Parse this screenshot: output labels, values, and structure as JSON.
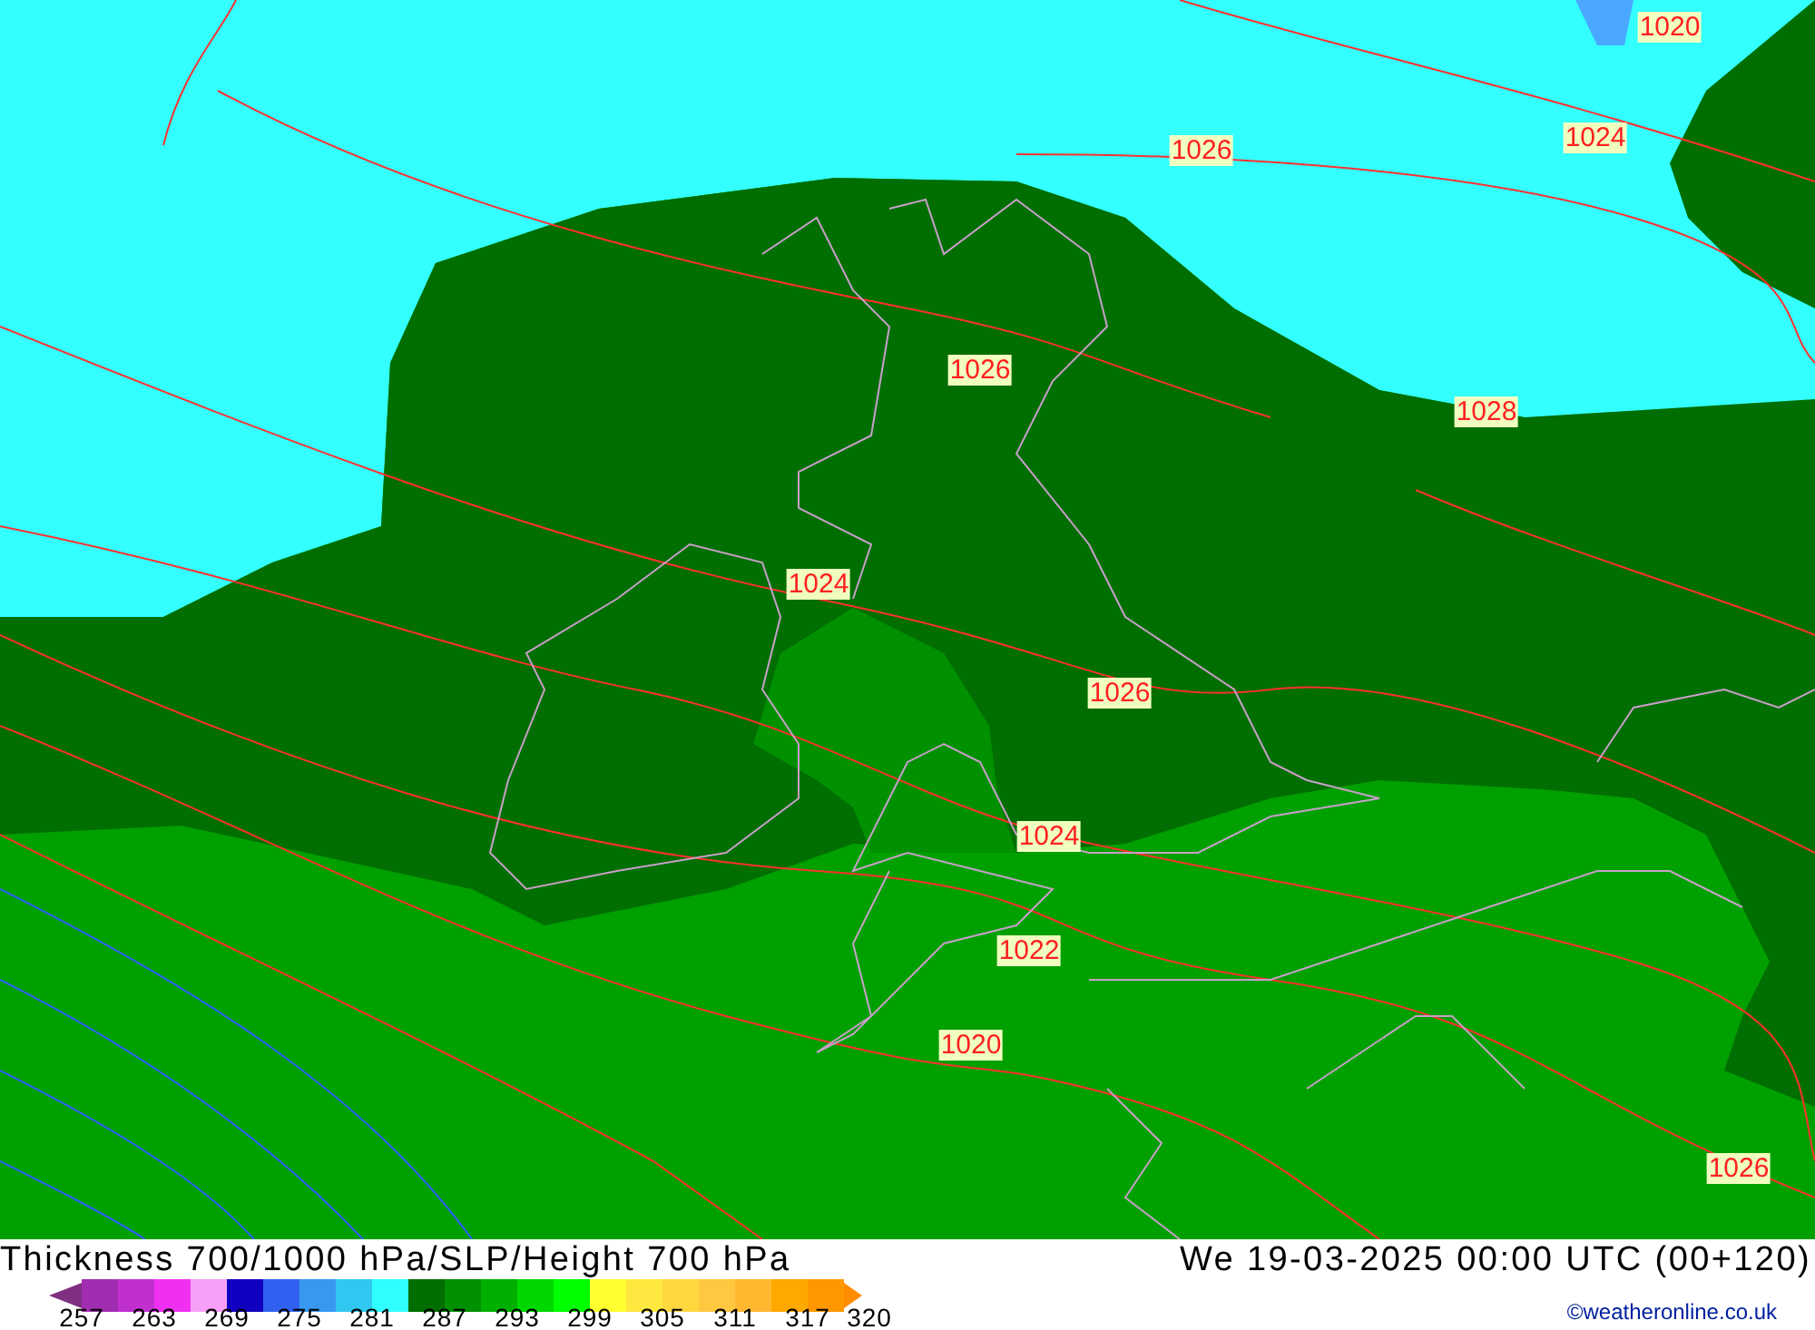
{
  "map": {
    "isobar_labels": [
      {
        "text": "1020"
      },
      {
        "text": "1026"
      },
      {
        "text": "1024"
      },
      {
        "text": "1026"
      },
      {
        "text": "1028"
      },
      {
        "text": "1024"
      },
      {
        "text": "1026"
      },
      {
        "text": "1024"
      },
      {
        "text": "1022"
      },
      {
        "text": "1020"
      },
      {
        "text": "1026"
      }
    ]
  },
  "footer": {
    "title": "Thickness 700/1000 hPa/SLP/Height 700 hPa",
    "datetime": "We 19-03-2025 00:00 UTC (00+120)",
    "credit": "©weatheronline.co.uk"
  },
  "legend": {
    "swatches": [
      {
        "color": "#a02cb0"
      },
      {
        "color": "#c030d0"
      },
      {
        "color": "#f030f0"
      },
      {
        "color": "#f8a0f8"
      },
      {
        "color": "#1000c0"
      },
      {
        "color": "#3060f0"
      },
      {
        "color": "#3898f0"
      },
      {
        "color": "#30c8f0"
      },
      {
        "color": "#30ffff"
      },
      {
        "color": "#006e00"
      },
      {
        "color": "#009000"
      },
      {
        "color": "#00b000"
      },
      {
        "color": "#00d800"
      },
      {
        "color": "#00ff00"
      },
      {
        "color": "#ffff30"
      },
      {
        "color": "#ffe840"
      },
      {
        "color": "#ffd840"
      },
      {
        "color": "#ffc840"
      },
      {
        "color": "#ffb830"
      },
      {
        "color": "#ffa800"
      },
      {
        "color": "#ff9800"
      }
    ],
    "labels": [
      "257",
      "263",
      "269",
      "275",
      "281",
      "287",
      "293",
      "299",
      "305",
      "311",
      "317",
      "320"
    ]
  }
}
